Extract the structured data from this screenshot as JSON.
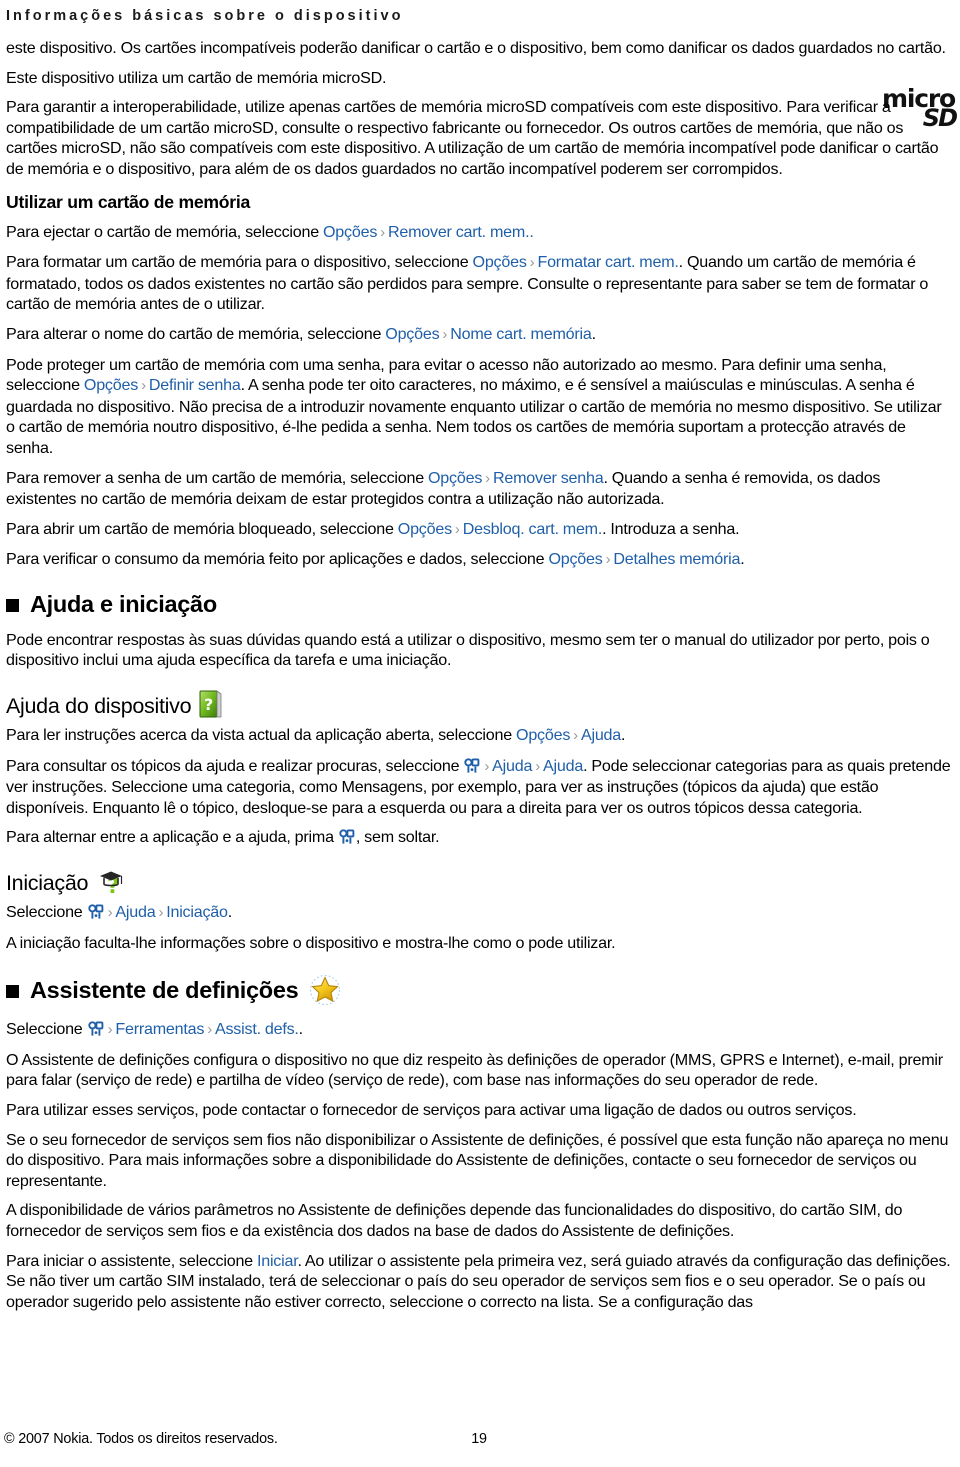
{
  "header": {
    "running_title": "Informações básicas sobre o dispositivo"
  },
  "logo": {
    "micro_text": "micro",
    "sd_text": "SD"
  },
  "content": {
    "p_incompat_1": "este dispositivo. Os cartões incompatíveis poderão danificar o cartão e o dispositivo, bem como danificar os dados guardados no cartão.",
    "p_utiliza_microsd": "Este dispositivo utiliza um cartão de memória microSD.",
    "p_interop": "Para garantir a interoperabilidade, utilize apenas cartões de memória microSD compatíveis com este dispositivo. Para verificar a compatibilidade de um cartão microSD, consulte o respectivo fabricante ou fornecedor. Os outros cartões de memória, que não os cartões microSD, não são compatíveis com este dispositivo. A utilização de um cartão de memória incompatível pode danificar o cartão de memória e o dispositivo, para além de os dados guardados no cartão incompatível poderem ser corrompidos.",
    "h_utilizar_cartao": "Utilizar um cartão de memória",
    "p_ejectar_pre": "Para ejectar o cartão de memória, seleccione ",
    "p_ejectar_post": "",
    "p_formatar_pre": "Para formatar um cartão de memória para o dispositivo, seleccione ",
    "p_formatar_post": ". Quando um cartão de memória é formatado, todos os dados existentes no cartão são perdidos para sempre. Consulte o representante para saber se tem de formatar o cartão de memória antes de o utilizar.",
    "p_alterar_nome_pre": "Para alterar o nome do cartão de memória, seleccione ",
    "p_alterar_nome_post": ".",
    "p_senha_pre": "Pode proteger um cartão de memória com uma senha, para evitar o acesso não autorizado ao mesmo. Para definir uma senha, seleccione ",
    "p_senha_post": ". A senha pode ter oito caracteres, no máximo, e é sensível a maiúsculas e minúsculas. A senha é guardada no dispositivo. Não precisa de a introduzir novamente enquanto utilizar o cartão de memória no mesmo dispositivo. Se utilizar o cartão de memória noutro dispositivo, é-lhe pedida a senha. Nem todos os cartões de memória suportam a protecção através de senha.",
    "p_remover_senha_pre": "Para remover a senha de um cartão de memória, seleccione ",
    "p_remover_senha_post": ". Quando a senha é removida, os dados existentes no cartão de memória deixam de estar protegidos contra a utilização não autorizada.",
    "p_desbloquear_pre": "Para abrir um cartão de memória bloqueado, seleccione ",
    "p_desbloquear_post": ". Introduza a senha.",
    "p_detalhes_pre": "Para verificar o consumo da memória feito por aplicações e dados, seleccione ",
    "p_detalhes_post": ".",
    "h_ajuda_iniciacao": "Ajuda e iniciação",
    "p_ajuda_intro": "Pode encontrar respostas às suas dúvidas quando está a utilizar o dispositivo, mesmo sem ter o manual do utilizador por perto, pois o dispositivo inclui uma ajuda específica da tarefa e uma iniciação.",
    "h_ajuda_dispositivo": "Ajuda do dispositivo",
    "p_ler_instrucoes_pre": "Para ler instruções acerca da vista actual da aplicação aberta, seleccione ",
    "p_ler_instrucoes_post": ".",
    "p_consultar_pre": "Para consultar os tópicos da ajuda e realizar procuras, seleccione ",
    "p_consultar_post": ". Pode seleccionar categorias para as quais pretende ver instruções. Seleccione uma categoria, como Mensagens, por exemplo, para ver as instruções (tópicos da ajuda) que estão disponíveis. Enquanto lê o tópico, desloque-se para a esquerda ou para a direita para ver os outros tópicos dessa categoria.",
    "p_alternar_pre": "Para alternar entre a aplicação e a ajuda, prima ",
    "p_alternar_post": ", sem soltar.",
    "h_iniciacao": "Iniciação",
    "p_iniciacao_sel_pre": "Seleccione ",
    "p_iniciacao_sel_post": ".",
    "p_iniciacao_desc": "A iniciação faculta-lhe informações sobre o dispositivo e mostra-lhe como o pode utilizar.",
    "h_assistente": "Assistente de definições",
    "p_assist_sel_pre": "Seleccione ",
    "p_assist_sel_post": ".",
    "p_assist_desc": "O Assistente de definições configura o dispositivo no que diz respeito às definições de operador (MMS, GPRS e Internet), e-mail, premir para falar (serviço de rede) e partilha de vídeo (serviço de rede), com base nas informações do seu operador de rede.",
    "p_assist_contactar": "Para utilizar esses serviços, pode contactar o fornecedor de serviços para activar uma ligação de dados ou outros serviços.",
    "p_assist_fornecedor": "Se o seu fornecedor de serviços sem fios não disponibilizar o Assistente de definições, é possível que esta função não apareça no menu do dispositivo. Para mais informações sobre a disponibilidade do Assistente de definições, contacte o seu fornecedor de serviços ou representante.",
    "p_assist_parametros": "A disponibilidade de vários parâmetros no Assistente de definições depende das funcionalidades do dispositivo, do cartão SIM, do fornecedor de serviços sem fios e da existência dos dados na base de dados do Assistente de definições.",
    "p_iniciar_pre": "Para iniciar o assistente, seleccione ",
    "p_iniciar_post": ". Ao utilizar o assistente pela primeira vez, será guiado através da configuração das definições. Se não tiver um cartão SIM instalado, terá de seleccionar o país do seu operador de serviços sem fios e o seu operador. Se o país ou operador sugerido pelo assistente não estiver correcto, seleccione o correcto na lista. Se a configuração das"
  },
  "links": {
    "opcoes": "Opções",
    "remover_cart_mem": "Remover cart. mem..",
    "formatar_cart_mem": "Formatar cart. mem.",
    "nome_cart_memoria": "Nome cart. memória",
    "definir_senha": "Definir senha",
    "remover_senha": "Remover senha",
    "desbloq_cart_mem": "Desbloq. cart. mem.",
    "detalhes_memoria": "Detalhes memória",
    "ajuda": "Ajuda",
    "iniciacao": "Iniciação",
    "ferramentas": "Ferramentas",
    "assist_defs": "Assist. defs.",
    "iniciar": "Iniciar"
  },
  "separator": "›",
  "icons": {
    "menu_key": "menu-key-icon",
    "help_book": "help-book-icon",
    "graduation_cap": "graduation-cap-icon",
    "star": "star-icon",
    "microsd": "microsd-logo"
  },
  "footer": {
    "copyright": "© 2007 Nokia. Todos os direitos reservados.",
    "page_number": "19"
  },
  "colors": {
    "link": "#1f5fa9",
    "separator": "#9a9a9a",
    "text": "#000000"
  }
}
